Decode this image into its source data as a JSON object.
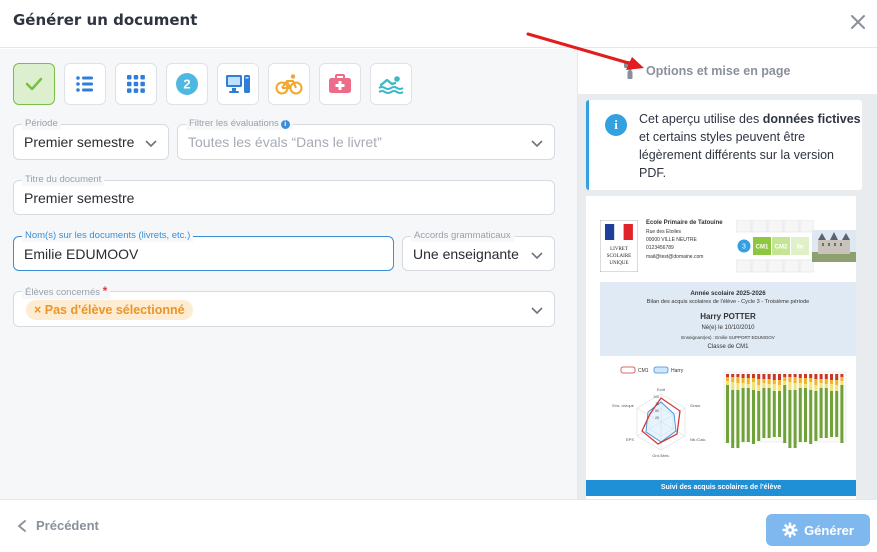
{
  "modal": {
    "title": "Générer un document"
  },
  "toolbar": {
    "tools": [
      {
        "icon": "check-icon",
        "active": true
      },
      {
        "icon": "list-icon"
      },
      {
        "icon": "grid-icon"
      },
      {
        "icon": "number-two-icon",
        "text": "2"
      },
      {
        "icon": "computer-icon"
      },
      {
        "icon": "bicycle-icon"
      },
      {
        "icon": "first-aid-kit-icon"
      },
      {
        "icon": "swimmer-icon"
      }
    ]
  },
  "form": {
    "periode": {
      "label": "Période",
      "value": "Premier semestre"
    },
    "filtre": {
      "label": "Filtrer les évaluations",
      "placeholder": "Toutes les évals “Dans le livret”"
    },
    "titre": {
      "label": "Titre du document",
      "value": "Premier semestre"
    },
    "noms": {
      "label": "Nom(s) sur les documents (livrets, etc.)",
      "value": "Emilie EDUMOOV"
    },
    "accords": {
      "label": "Accords grammaticaux",
      "value": "Une enseignante"
    },
    "eleves": {
      "label": "Élèves concernés",
      "required": "*",
      "chip": "× Pas d'élève sélectionné"
    }
  },
  "preview": {
    "options_label": "Options et mise en page",
    "info": {
      "icon_text": "i",
      "part1": "Cet aperçu utilise des ",
      "bold1": "données fictives",
      "part2": " et certains styles peuvent être légèrement différents sur la version PDF."
    },
    "doc": {
      "school": "Ecole Primaire de Tatouine",
      "address1": "Rue des Etoiles",
      "address2": "00000 VILLE NEUTRE",
      "phone": "0123456789",
      "email": "mail@test@domaine.com",
      "livret1": "LIVRET",
      "livret2": "SCOLAIRE",
      "livret3": "UNIQUE",
      "year": "Année scolaire 2025-2026",
      "bilan": "Bilan des acquis scolaires de l'élève - Cycle 3 - Troisième période",
      "student": "Harry POTTER",
      "born": "Né(e) le 10/10/2010",
      "teacher": "Enseignant(es) : Emilie SUPPORT EDUMOOV",
      "classe": "Classe de CM1",
      "cycle_num": "3",
      "cycle_cm1": "CM1",
      "cycle_cm2": "CM2",
      "cycle_6e": "6e",
      "legend_cm1": "CM1",
      "legend_harry": "Harry",
      "radar_labels": [
        "Ecrit",
        "Gram.",
        "Nb./Calc.",
        "Grd./Mes.",
        "EPS",
        "Ens. civique"
      ],
      "radar_ticks": [
        "100",
        "75",
        "50",
        "25"
      ],
      "footer": "Suivi des acquis scolaires de l'élève"
    }
  },
  "footer": {
    "prev_label": "Précédent",
    "gen_label": "Générer"
  }
}
